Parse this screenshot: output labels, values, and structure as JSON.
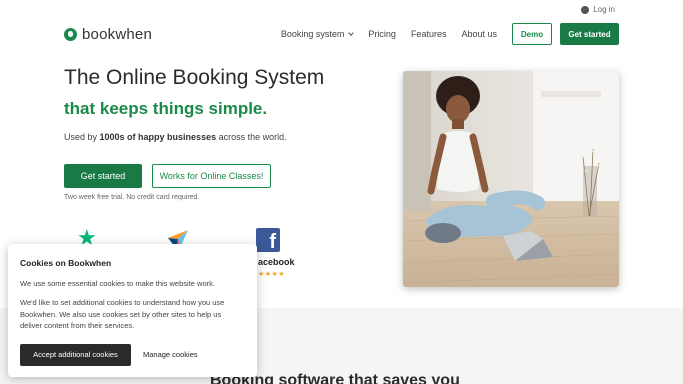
{
  "header": {
    "login_label": "Log in",
    "logo_text": "bookwhen",
    "nav": [
      {
        "label": "Booking system",
        "has_dropdown": true
      },
      {
        "label": "Pricing"
      },
      {
        "label": "Features"
      },
      {
        "label": "About us"
      }
    ],
    "demo_label": "Demo",
    "get_started_label": "Get started"
  },
  "hero": {
    "title": "The Online Booking System",
    "subtitle": "that keeps things simple.",
    "desc_prefix": "Used by ",
    "desc_bold": "1000s of happy businesses",
    "desc_suffix": " across the world.",
    "get_started_label": "Get started",
    "online_classes_label": "Works for Online Classes!",
    "trial_note": "Two week free trial. No credit card required."
  },
  "ratings": {
    "trustpilot_icon": "trustpilot-star-icon",
    "capterra_icon": "capterra-icon",
    "facebook_icon": "facebook-icon",
    "facebook_label": "acebook",
    "facebook_stars": "★★★★",
    "facebook_rating": 4
  },
  "lower": {
    "title": "Booking software that saves you"
  },
  "cookie": {
    "title": "Cookies on Bookwhen",
    "p1": "We use some essential cookies to make this website work.",
    "p2": "We'd like to set additional cookies to understand how you use Bookwhen. We also use cookies set by other sites to help us deliver content from their services.",
    "accept_label": "Accept additional cookies",
    "manage_label": "Manage cookies"
  },
  "colors": {
    "brand_green": "#1a8a4b",
    "button_green": "#1a7a45",
    "facebook_blue": "#3b5998",
    "trustpilot_green": "#00b67a",
    "dark_button": "#2a2a2a"
  }
}
